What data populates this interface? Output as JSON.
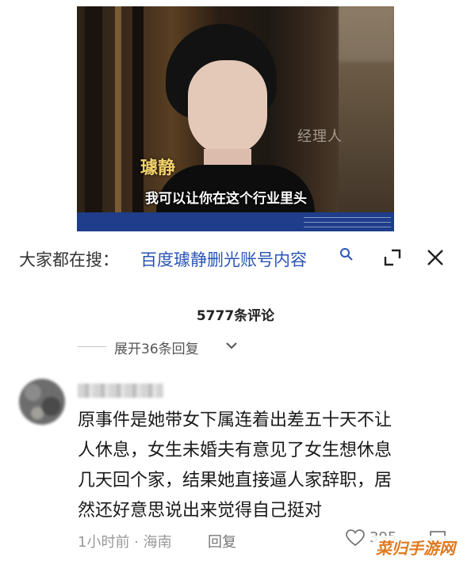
{
  "video": {
    "name_tag": "璩静",
    "subtitle": "我可以让你在这个行业里头",
    "watermark": "经理人"
  },
  "search_bar": {
    "label": "大家都在搜：",
    "query": "百度璩静删光账号内容"
  },
  "comments": {
    "count_label": "5777条评论",
    "expand_label": "展开36条回复",
    "comment": {
      "lines": [
        "原事件是她带女下属连着出差五十天不让",
        "人休息，女生未婚夫有意见了女生想休息",
        "几天回个家，结果她直接逼人家辞职，居",
        "然还好意思说出来觉得自己挺对"
      ],
      "time_location": "1小时前 · 海南",
      "reply_label": "回复",
      "like_count": "395"
    }
  },
  "site_logo": "菜归手游网",
  "colors": {
    "link_blue": "#2b56b6",
    "subtitle_blue_bar": "#1f3d8a",
    "name_gold": "#f2d16b",
    "logo_orange": "#e07a1f"
  },
  "icons": [
    "search-icon",
    "shrink-icon",
    "close-icon",
    "chevron-down-icon",
    "heart-icon",
    "comment-bubble-icon"
  ]
}
